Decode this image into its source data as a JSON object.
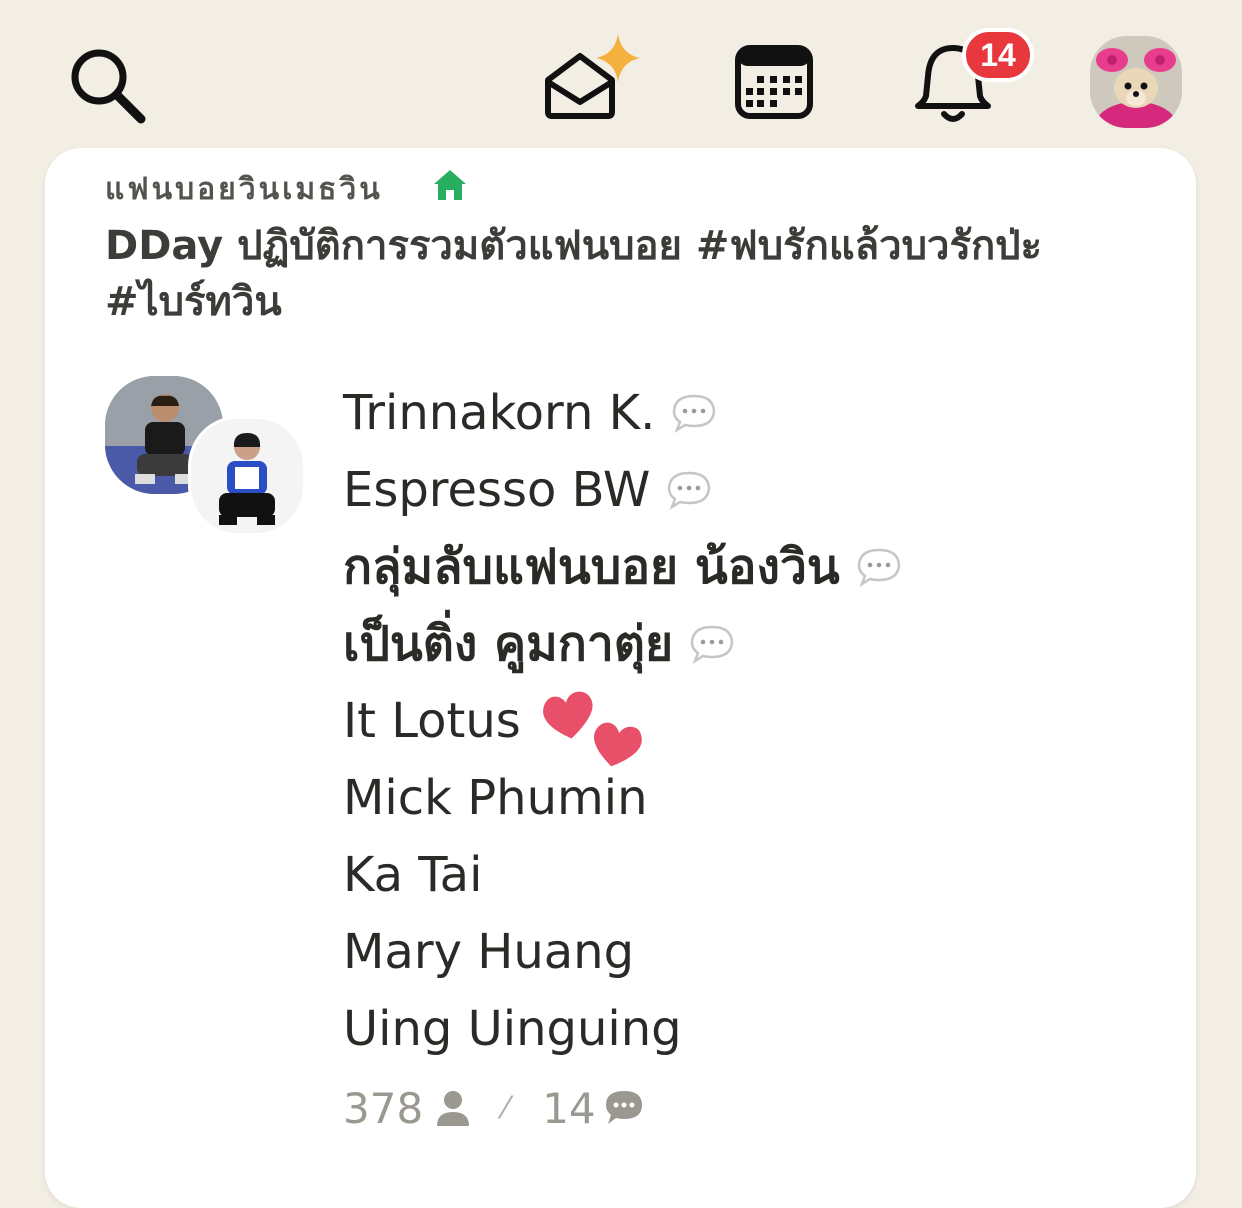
{
  "topbar": {
    "notification_count": "14"
  },
  "room": {
    "club_name": "แฟนบอยวินเมธวิน",
    "title": "DDay ปฏิบัติการรวมตัวแฟนบอย #ฟบรักแล้วบวรักป่ะ #ไบร์ทวิน"
  },
  "speakers": [
    {
      "name": "Trinnakorn K.",
      "icon": "speech-bubble-icon"
    },
    {
      "name": "Espresso BW",
      "icon": "speech-bubble-icon"
    },
    {
      "name": "กลุ่มลับแฟนบอย น้องวิน",
      "icon": "speech-bubble-icon"
    },
    {
      "name": "เป็นติ่ง คูมกาตุ่ย",
      "icon": "speech-bubble-icon"
    },
    {
      "name": "It Lotus",
      "icon": "two-hearts-icon"
    },
    {
      "name": "Mick Phumin"
    },
    {
      "name": "Ka Tai"
    },
    {
      "name": "Mary Huang"
    },
    {
      "name": "Uing Uinguing"
    }
  ],
  "stats": {
    "listeners": "378",
    "separator": "⁄",
    "speakers": "14"
  },
  "colors": {
    "background": "#f2eee4",
    "card": "#ffffff",
    "badge": "#e8383d",
    "house": "#27ae60",
    "heart": "#e8506a"
  }
}
